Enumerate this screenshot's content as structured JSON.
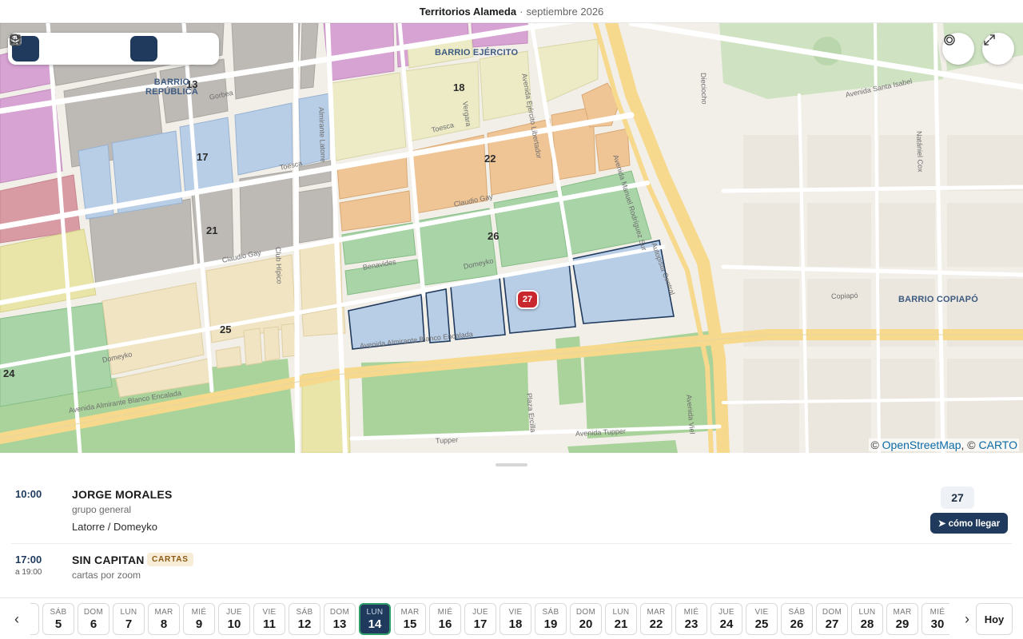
{
  "header": {
    "title": "Territorios Alameda",
    "separator": "·",
    "subtitle": "septiembre 2026"
  },
  "toolbar": {
    "buttons": [
      {
        "name": "map-view",
        "icon": "map-icon",
        "active": true
      },
      {
        "name": "document",
        "icon": "document-icon",
        "active": false
      },
      {
        "name": "copy",
        "icon": "copy-icon",
        "active": false
      },
      {
        "name": "edit",
        "icon": "pencil-icon",
        "active": false
      },
      {
        "name": "grid",
        "icon": "grid-icon",
        "active": true
      },
      {
        "name": "square",
        "icon": "square-icon",
        "active": false
      },
      {
        "name": "layers",
        "icon": "layers-icon",
        "active": false
      }
    ]
  },
  "map": {
    "territory_numbers": [
      "13",
      "18",
      "17",
      "22",
      "21",
      "26",
      "25",
      "24"
    ],
    "barrios": [
      "BARRIO EJÉRCITO",
      "BARRIO REPÚBLICA",
      "BARRIO COPIAPÓ"
    ],
    "streets": [
      "Avenida Almirante Blanco Encalada",
      "Avenida Manuel Rodríguez Sur",
      "Autopista Central",
      "Avenida Santa Isabel",
      "Toesca",
      "Gorbea",
      "Domeyko",
      "Claudio Gay",
      "Almirante Latorre",
      "Avenida Ejército Libertador",
      "Vergara",
      "Club Hípico",
      "Copiapó",
      "Avenida Viel",
      "Avenida Tupper",
      "Tupper",
      "Plaza Ercilla",
      "Natániel Cox",
      "Dieciocho",
      "Benavides"
    ],
    "marker": "27",
    "attribution": {
      "prefix": "©",
      "osm": "OpenStreetMap",
      "mid": ", ©",
      "carto": "CARTO"
    },
    "colors": {
      "purple": "#d7a3d3",
      "gray": "#bdbab6",
      "blue": "#b8cde6",
      "yellow": "#e9e5a8",
      "orange": "#f0c596",
      "green": "#a8d4a8",
      "cream": "#f1e4c3",
      "marker": "#c8282d"
    }
  },
  "events": [
    {
      "time": "10:00",
      "title": "JORGE MORALES",
      "group": "grupo general",
      "place": "Latorre / Domeyko",
      "territory": "27",
      "action": "➤ cómo llegar"
    },
    {
      "time": "17:00",
      "subtime": "a 19:00",
      "title": "SIN CAPITAN",
      "badge": "CARTAS",
      "group": "cartas por zoom"
    }
  ],
  "strip": {
    "prev": "‹",
    "next": "›",
    "today": "Hoy",
    "days": [
      {
        "dw": "",
        "dn": ""
      },
      {
        "dw": "SÁB",
        "dn": "5"
      },
      {
        "dw": "DOM",
        "dn": "6"
      },
      {
        "dw": "LUN",
        "dn": "7"
      },
      {
        "dw": "MAR",
        "dn": "8"
      },
      {
        "dw": "MIÉ",
        "dn": "9"
      },
      {
        "dw": "JUE",
        "dn": "10"
      },
      {
        "dw": "VIE",
        "dn": "11"
      },
      {
        "dw": "SÁB",
        "dn": "12"
      },
      {
        "dw": "DOM",
        "dn": "13"
      },
      {
        "dw": "LUN",
        "dn": "14",
        "active": true
      },
      {
        "dw": "MAR",
        "dn": "15"
      },
      {
        "dw": "MIÉ",
        "dn": "16"
      },
      {
        "dw": "JUE",
        "dn": "17"
      },
      {
        "dw": "VIE",
        "dn": "18"
      },
      {
        "dw": "SÁB",
        "dn": "19"
      },
      {
        "dw": "DOM",
        "dn": "20"
      },
      {
        "dw": "LUN",
        "dn": "21"
      },
      {
        "dw": "MAR",
        "dn": "22"
      },
      {
        "dw": "MIÉ",
        "dn": "23"
      },
      {
        "dw": "JUE",
        "dn": "24"
      },
      {
        "dw": "VIE",
        "dn": "25"
      },
      {
        "dw": "SÁB",
        "dn": "26"
      },
      {
        "dw": "DOM",
        "dn": "27"
      },
      {
        "dw": "LUN",
        "dn": "28"
      },
      {
        "dw": "MAR",
        "dn": "29"
      },
      {
        "dw": "MIÉ",
        "dn": "30"
      }
    ]
  }
}
